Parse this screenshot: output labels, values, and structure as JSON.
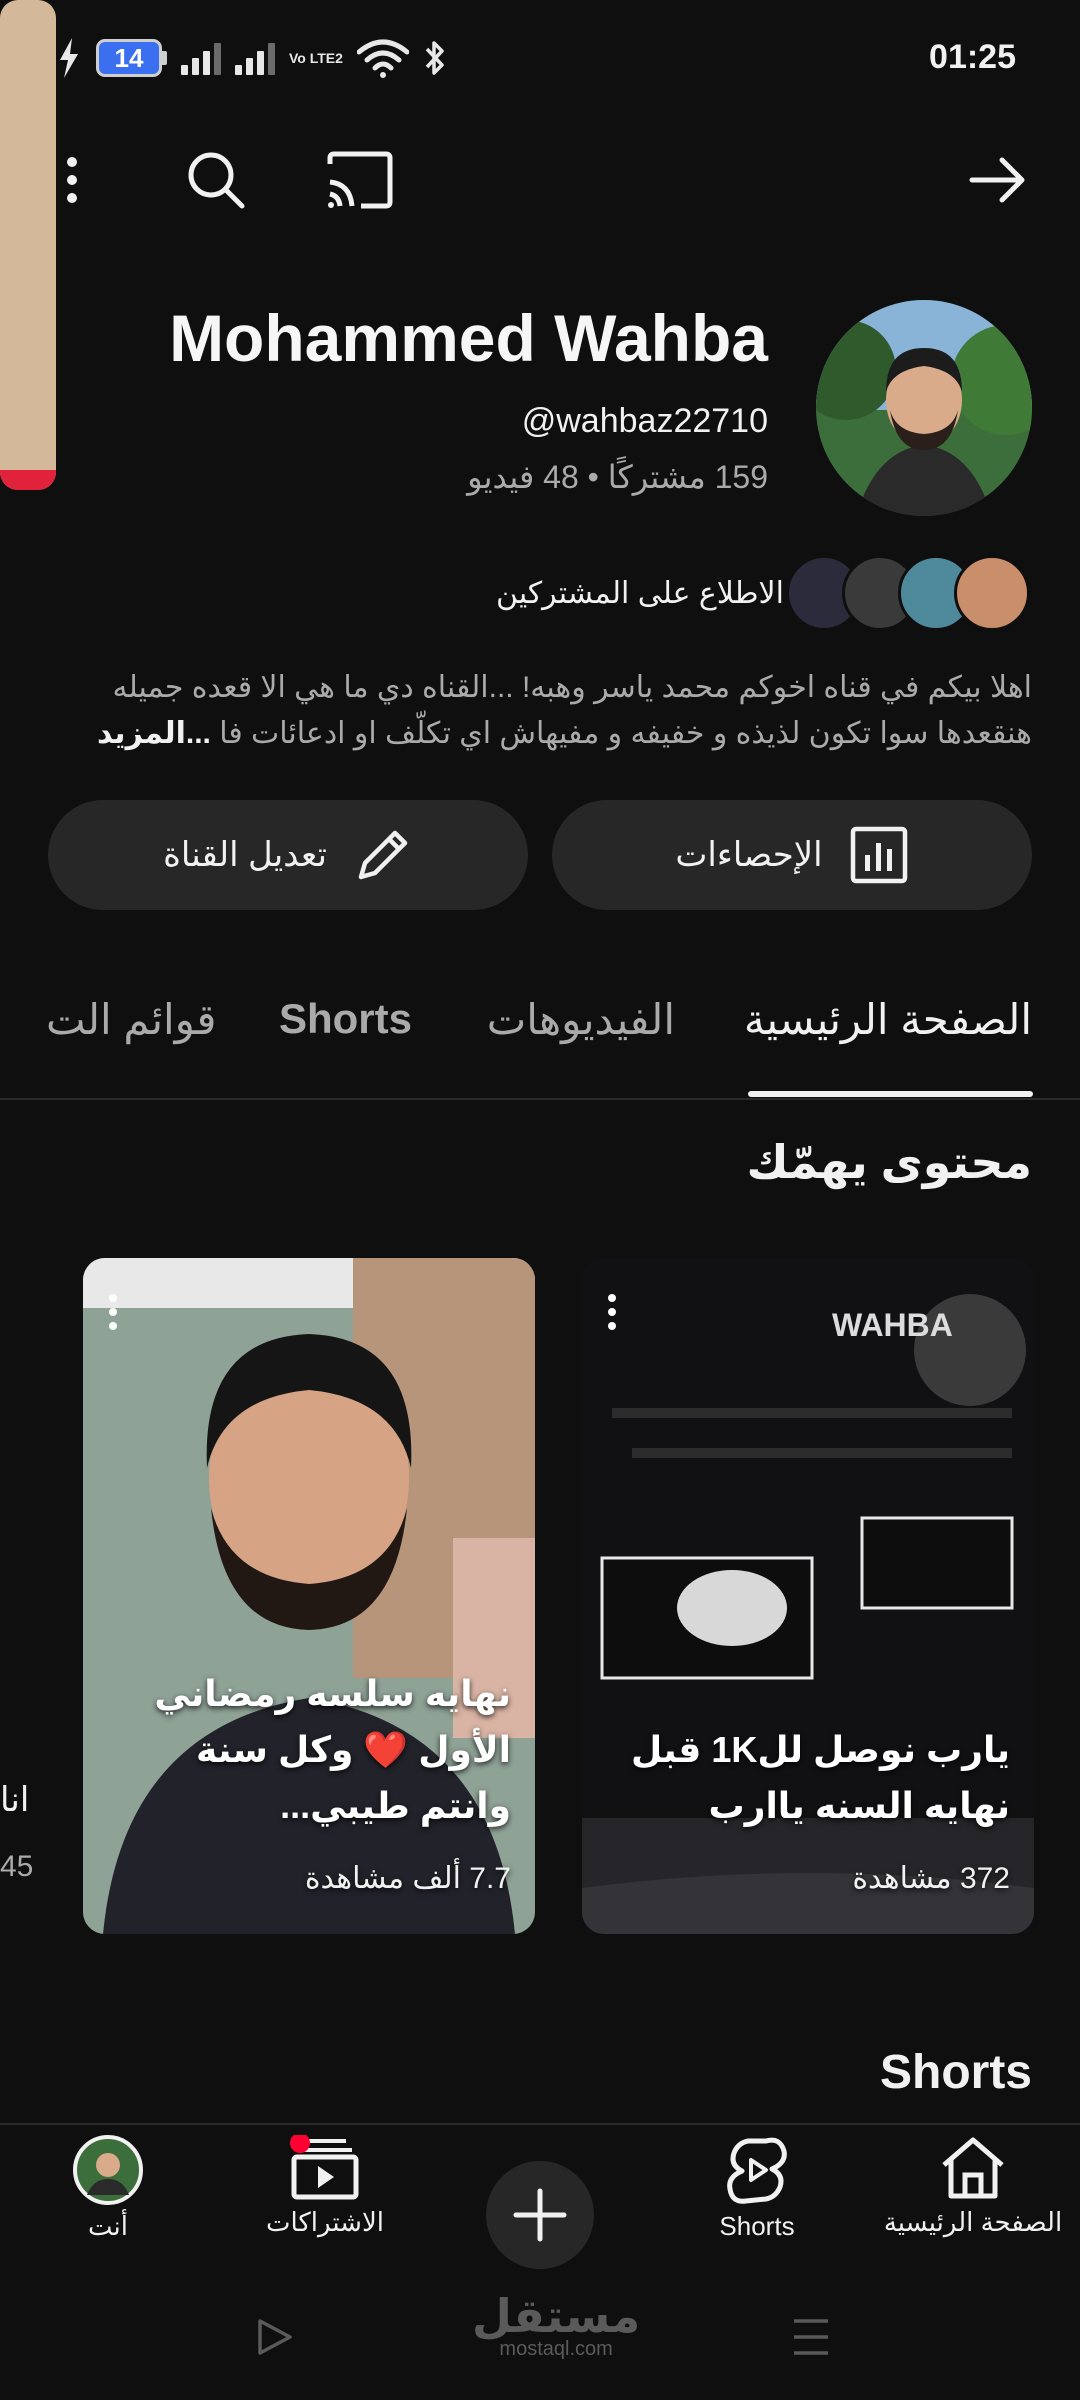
{
  "status_bar": {
    "battery": "14",
    "network": "Vo LTE2",
    "time": "01:25"
  },
  "top_bar": {
    "icons": [
      "more-vert-icon",
      "search-icon",
      "cast-icon",
      "forward-arrow-icon"
    ]
  },
  "channel": {
    "name": "Mohammed Wahba",
    "handle": "@wahbaz22710",
    "stats": "159 مشتركًا • 48 فيديو",
    "subscribers_link": "الاطلاع على المشتركين",
    "description_line1": "اهلا بيكم في قناه اخوكم محمد ياسر وهبه! ...القناه دي ما هي الا قعده جميله",
    "description_line2": "هنقعدها سوا تكون لذيذه و خفيفه و مفيهاش اي تكلّف او ادعائات فا",
    "description_more": "...المزيد"
  },
  "buttons": {
    "edit": "تعديل القناة",
    "analytics": "الإحصاءات"
  },
  "tabs": [
    "الصفحة الرئيسية",
    "الفيديوهات",
    "Shorts",
    "قوائم الت"
  ],
  "section": {
    "title": "محتوى يهمّك"
  },
  "cards": [
    {
      "title": "يارب نوصل لل1K قبل نهايه السنه ياارب",
      "views": "372 مشاهدة"
    },
    {
      "title": "نهايه سلسه رمضاني الأول ❤️ وكل سنة وانتم طيبي...",
      "views": "7.7 ألف مشاهدة"
    }
  ],
  "partial_card": {
    "text": "انا",
    "views": "45"
  },
  "shorts_section": {
    "title": "Shorts"
  },
  "bottom_nav": {
    "home": "الصفحة الرئيسية",
    "shorts": "Shorts",
    "subscriptions": "الاشتراكات",
    "you": "أنت"
  },
  "watermark": {
    "arabic": "مستقل",
    "latin": "mostaql.com"
  },
  "colors": {
    "background": "#0f0f0f",
    "surface": "#272727",
    "accent": "#ff0033",
    "text": "#f1f1f1",
    "muted": "#aaaaaa"
  }
}
